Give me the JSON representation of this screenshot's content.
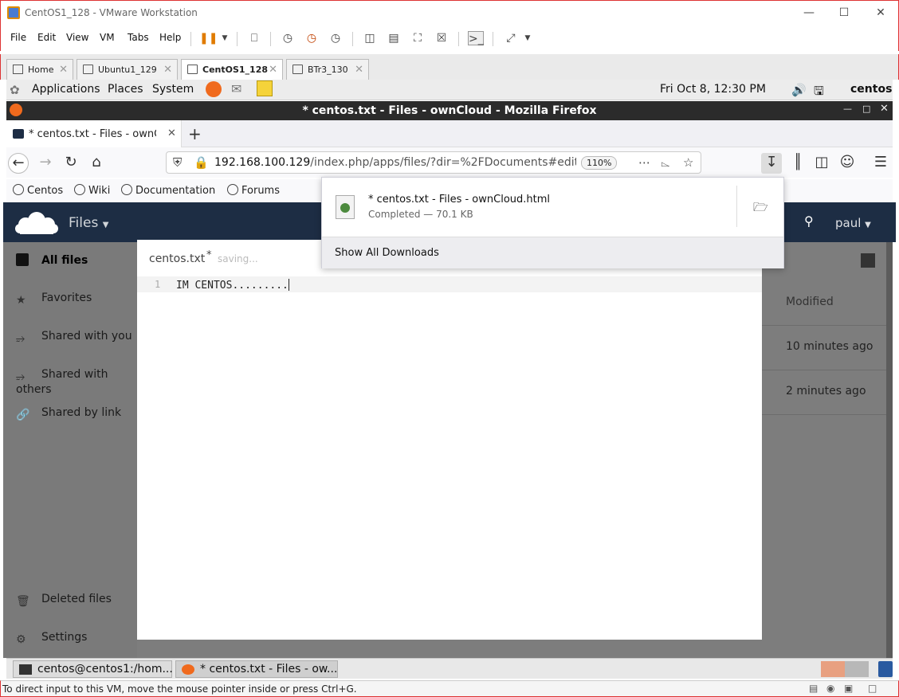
{
  "vmware": {
    "title": "CentOS1_128 - VMware Workstation",
    "menu": [
      "File",
      "Edit",
      "View",
      "VM",
      "Tabs",
      "Help"
    ],
    "tabs": [
      {
        "label": "Home",
        "active": false
      },
      {
        "label": "Ubuntu1_129",
        "active": false
      },
      {
        "label": "CentOS1_128",
        "active": true
      },
      {
        "label": "BTr3_130",
        "active": false
      }
    ],
    "status_message": "To direct input to this VM, move the mouse pointer inside or press Ctrl+G."
  },
  "gnome_panel": {
    "menus": [
      "Applications",
      "Places",
      "System"
    ],
    "clock": "Fri Oct  8, 12:30 PM",
    "user": "centos"
  },
  "firefox": {
    "window_title": "* centos.txt - Files - ownCloud - Mozilla Firefox",
    "tab_label": "* centos.txt - Files - ownCloud",
    "url_host": "192.168.100.129",
    "url_path": "/index.php/apps/files/?dir=%2FDocuments#edit",
    "zoom": "110%",
    "bookmarks": [
      "Centos",
      "Wiki",
      "Documentation",
      "Forums"
    ]
  },
  "downloads": {
    "file_name": "* centos.txt - Files - ownCloud.html",
    "status": "Completed — 70.1 KB",
    "show_all": "Show All Downloads"
  },
  "owncloud": {
    "app_name": "Files",
    "user": "paul",
    "nav": [
      "All files",
      "Favorites",
      "Shared with you",
      "Shared with others",
      "Shared by link"
    ],
    "nav_bottom": [
      "Deleted files",
      "Settings"
    ],
    "column_modified": "Modified",
    "rows_modified": [
      "10 minutes ago",
      "2 minutes ago"
    ]
  },
  "editor": {
    "file_name": "centos.txt",
    "modified_marker": "*",
    "saving_text": "saving...",
    "line_number": "1",
    "content": "IM CENTOS........."
  },
  "taskbar": [
    {
      "label": "centos@centos1:/hom..."
    },
    {
      "label": "* centos.txt - Files - ow..."
    }
  ],
  "colors": {
    "owncloud_header": "#1d2d44",
    "vmware_border": "#dd3333"
  }
}
